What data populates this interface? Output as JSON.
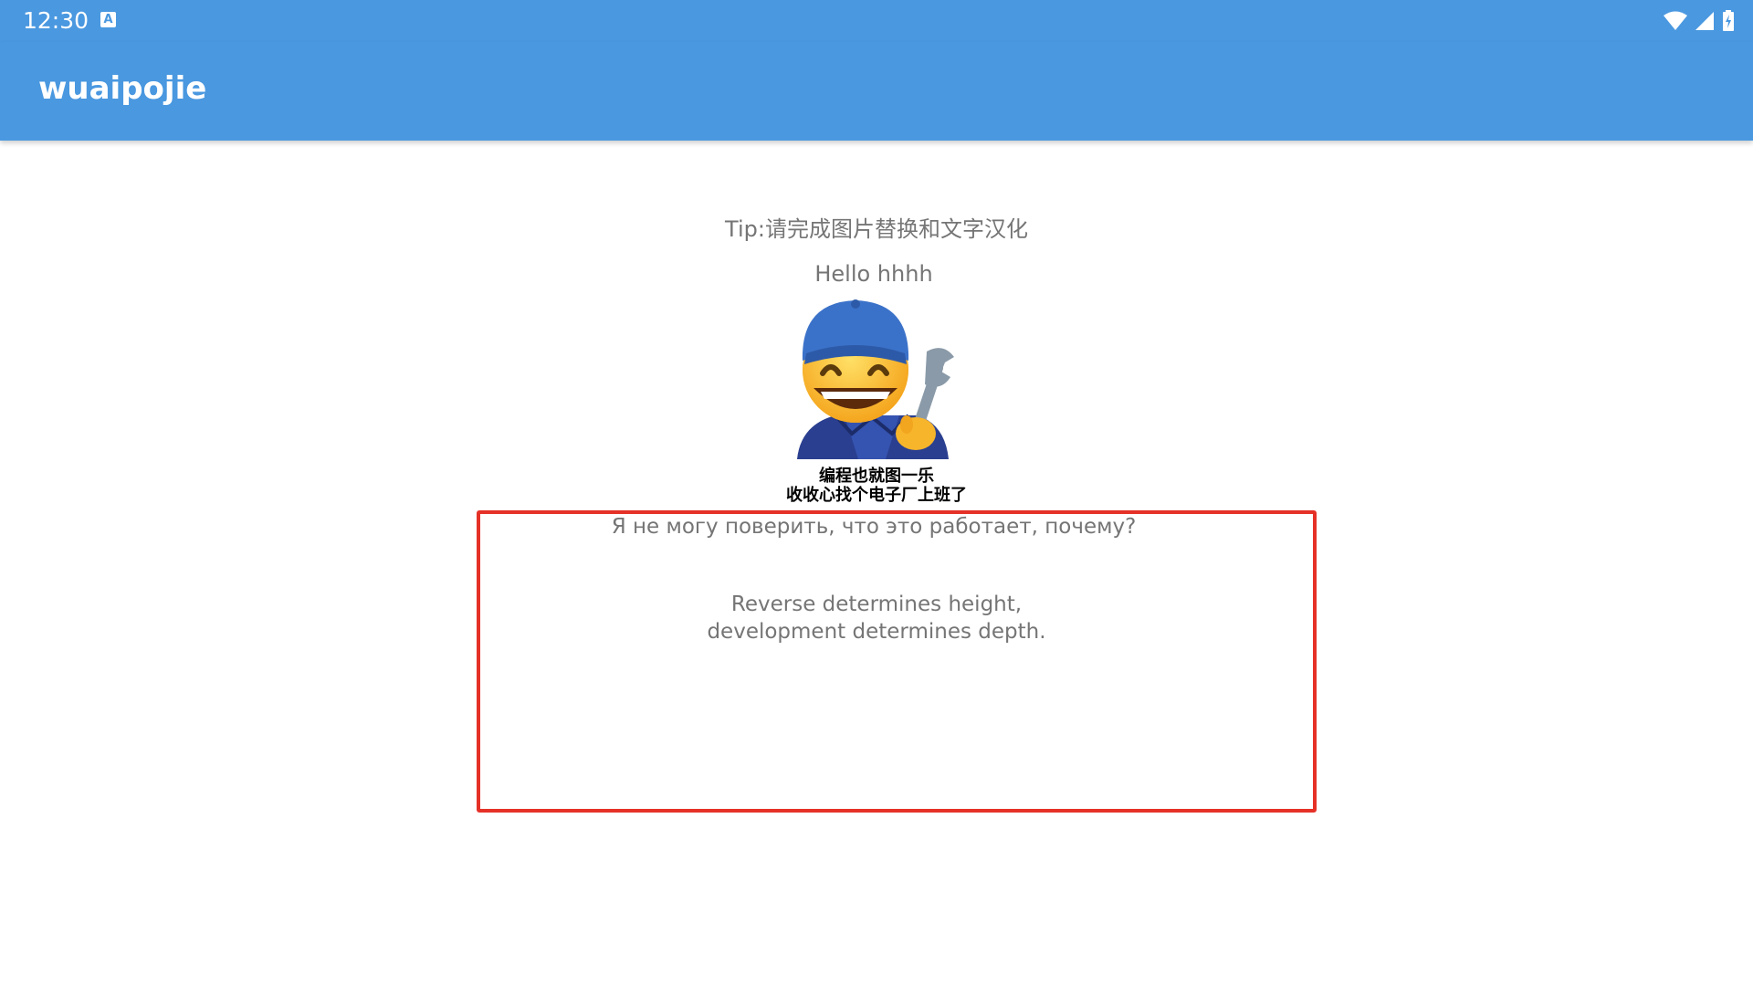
{
  "status_bar": {
    "time": "12:30",
    "notification_icon": "a-icon",
    "icons": [
      "wifi-icon",
      "signal-icon",
      "battery-icon"
    ],
    "background": "#4a98e0"
  },
  "app_bar": {
    "title": "wuaipojie",
    "background": "#4a98e0"
  },
  "content": {
    "tip": "Tip:请完成图片替换和文字汉化",
    "hello": "Hello hhhh",
    "image": {
      "icon": "mechanic-emoji-icon",
      "caption_line1": "编程也就图一乐",
      "caption_line2": "收收心找个电子厂上班了"
    },
    "russian_text": "Я не могу поверить, что это работает, почему?",
    "english_line1": "Reverse determines height,",
    "english_line2": "development determines depth.",
    "highlight_color": "#e53127"
  }
}
